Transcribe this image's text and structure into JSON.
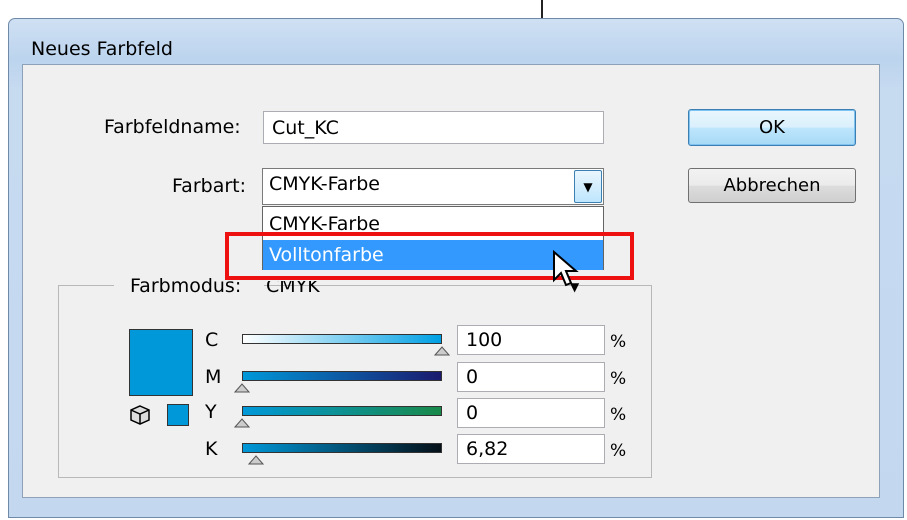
{
  "window": {
    "title": "Neues Farbfeld"
  },
  "fields": {
    "swatch_name_label": "Farbfeldname:",
    "swatch_name_value": "Cut_KC",
    "color_type_label": "Farbart:",
    "color_type_value": "CMYK-Farbe",
    "color_mode_label": "Farbmodus:",
    "color_mode_value": "CMYK"
  },
  "dropdown": {
    "options": [
      "CMYK-Farbe",
      "Volltonfarbe"
    ],
    "highlighted": "Volltonfarbe"
  },
  "buttons": {
    "ok": "OK",
    "cancel": "Abbrechen"
  },
  "channels": [
    {
      "label": "C",
      "value": "100",
      "unit": "%",
      "fraction": 1.0
    },
    {
      "label": "M",
      "value": "0",
      "unit": "%",
      "fraction": 0.0
    },
    {
      "label": "Y",
      "value": "0",
      "unit": "%",
      "fraction": 0.0
    },
    {
      "label": "K",
      "value": "6,82",
      "unit": "%",
      "fraction": 0.0682
    }
  ],
  "colors": {
    "swatch": "#0098d9",
    "highlight": "#3399ff",
    "annotation": "#ee1111"
  },
  "icons": {
    "dropdown_arrow": "chevron-down-icon",
    "gamut": "cube-icon",
    "pointer": "mouse-pointer-icon"
  }
}
